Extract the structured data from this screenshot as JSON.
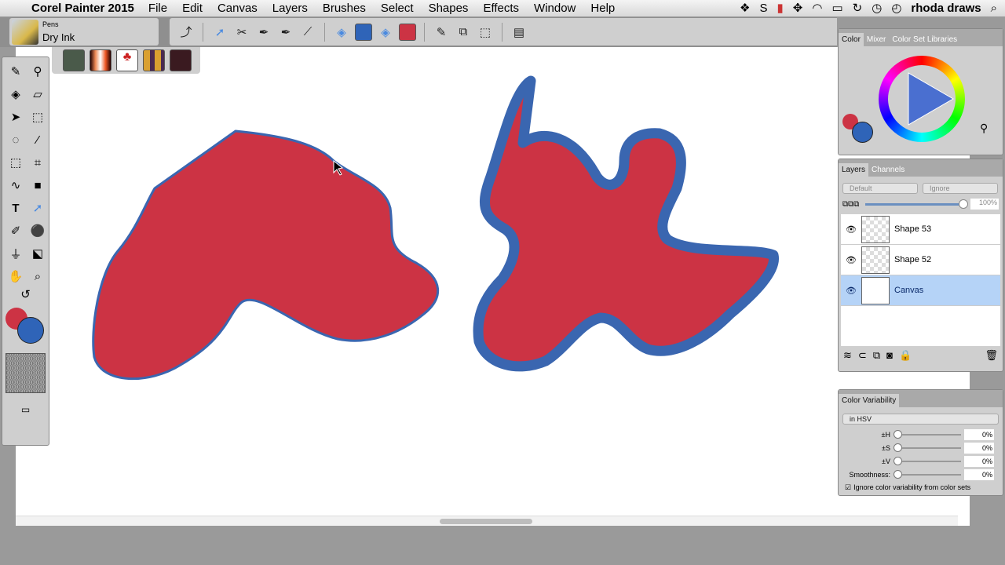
{
  "menubar": {
    "app": "Corel Painter 2015",
    "items": [
      "File",
      "Edit",
      "Canvas",
      "Layers",
      "Brushes",
      "Select",
      "Shapes",
      "Effects",
      "Window",
      "Help"
    ],
    "user": "rhoda draws"
  },
  "brush": {
    "category": "Pens",
    "variant": "Dry Ink"
  },
  "colors": {
    "main": "#cc3344",
    "additional": "#2f64b8",
    "stroke": "#3a66b0"
  },
  "color_panel": {
    "tabs": [
      "Color",
      "Mixer",
      "Color Set Libraries"
    ]
  },
  "layers_panel": {
    "tabs": [
      "Layers",
      "Channels"
    ],
    "composite_method": "Default",
    "depth": "Ignore",
    "opacity": "100%",
    "opacity_value": 100,
    "layers": [
      {
        "name": "Shape 53",
        "selected": false
      },
      {
        "name": "Shape 52",
        "selected": false
      },
      {
        "name": "Canvas",
        "selected": true
      }
    ]
  },
  "color_variability": {
    "title": "Color Variability",
    "mode": "in HSV",
    "rows": [
      {
        "label": "±H",
        "value": "0%"
      },
      {
        "label": "±S",
        "value": "0%"
      },
      {
        "label": "±V",
        "value": "0%"
      },
      {
        "label": "Smoothness:",
        "value": "0%"
      }
    ],
    "ignore_label": "Ignore color variability from color sets",
    "ignore_checked": true
  }
}
